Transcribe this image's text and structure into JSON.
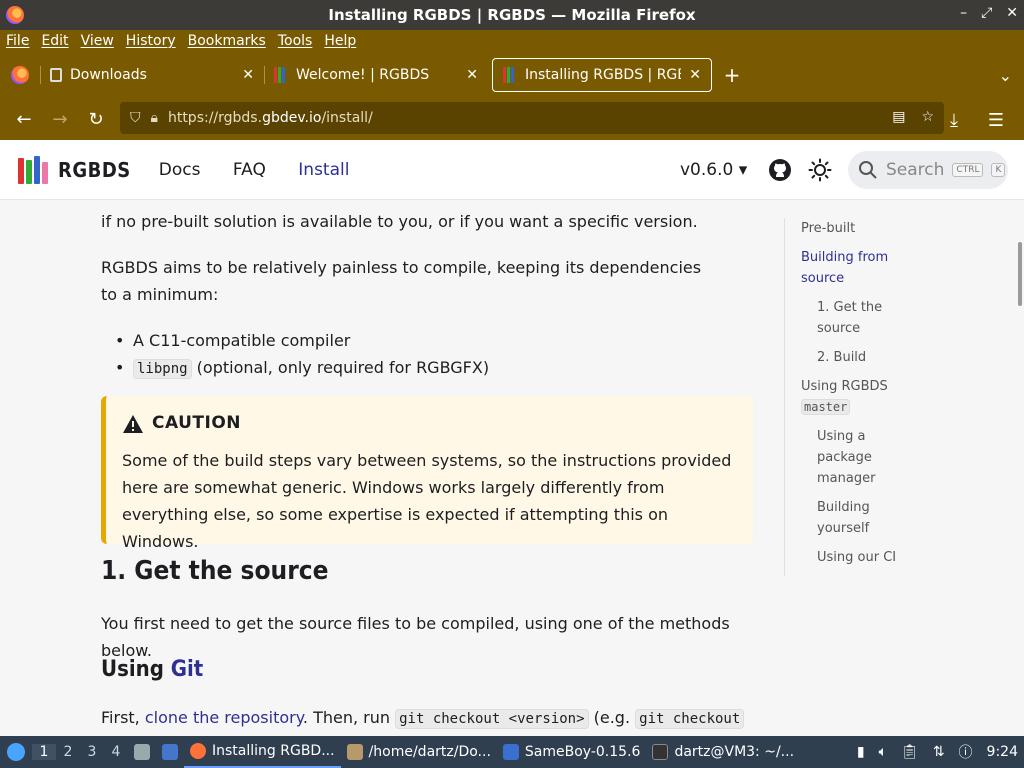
{
  "window": {
    "title": "Installing RGBDS | RGBDS — Mozilla Firefox",
    "controls": [
      "–",
      "⤢",
      "✕"
    ]
  },
  "menubar": [
    "File",
    "Edit",
    "View",
    "History",
    "Bookmarks",
    "Tools",
    "Help"
  ],
  "tabs": [
    {
      "label": "Downloads",
      "close": "✕"
    },
    {
      "label": "Welcome! | RGBDS",
      "close": "✕"
    },
    {
      "label": "Installing RGBDS | RGBDS",
      "close": "✕"
    }
  ],
  "newtab": "+",
  "url": {
    "prefix": "https://rgbds.",
    "domain": "gbdev.io",
    "path": "/install/"
  },
  "site": {
    "name": "RGBDS",
    "nav": [
      "Docs",
      "FAQ",
      "Install"
    ],
    "version": "v0.6.0",
    "search_placeholder": "Search",
    "kbd1": "CTRL",
    "kbd2": "K"
  },
  "content": {
    "p1": "if no pre-built solution is available to you, or if you want a specific version.",
    "p2": "RGBDS aims to be relatively painless to compile, keeping its dependencies to a minimum:",
    "li1": "A C11-compatible compiler",
    "li2_code": "libpng",
    "li2_text": " (optional, only required for RGBGFX)",
    "caution_title": "CAUTION",
    "caution_body": "Some of the build steps vary between systems, so the instructions provided here are somewhat generic. Windows works largely differently from everything else, so some expertise is expected if attempting this on Windows.",
    "h2": "1. Get the source",
    "p3": "You first need to get the source files to be compiled, using one of the methods below.",
    "h3_prefix": "Using ",
    "h3_link": "Git",
    "p4_a": "First, ",
    "p4_link": "clone the repository",
    "p4_b": ". Then, run ",
    "p4_code1": "git checkout <version>",
    "p4_c": " (e.g. ",
    "p4_code2": "git checkout"
  },
  "toc": [
    {
      "label": "Pre-built"
    },
    {
      "label": "Building from source"
    },
    {
      "label": "1. Get the source"
    },
    {
      "label": "2. Build"
    },
    {
      "label": "Using RGBDS",
      "code": "master"
    },
    {
      "label": "Using a package manager"
    },
    {
      "label": "Building yourself"
    },
    {
      "label": "Using our CI"
    }
  ],
  "taskbar": {
    "workspaces": [
      "1",
      "2",
      "3",
      "4"
    ],
    "tasks": [
      "Installing RGBD...",
      "/home/dartz/Do...",
      "SameBoy-0.15.6",
      "dartz@VM3: ~/..."
    ],
    "clock": "9:24"
  }
}
